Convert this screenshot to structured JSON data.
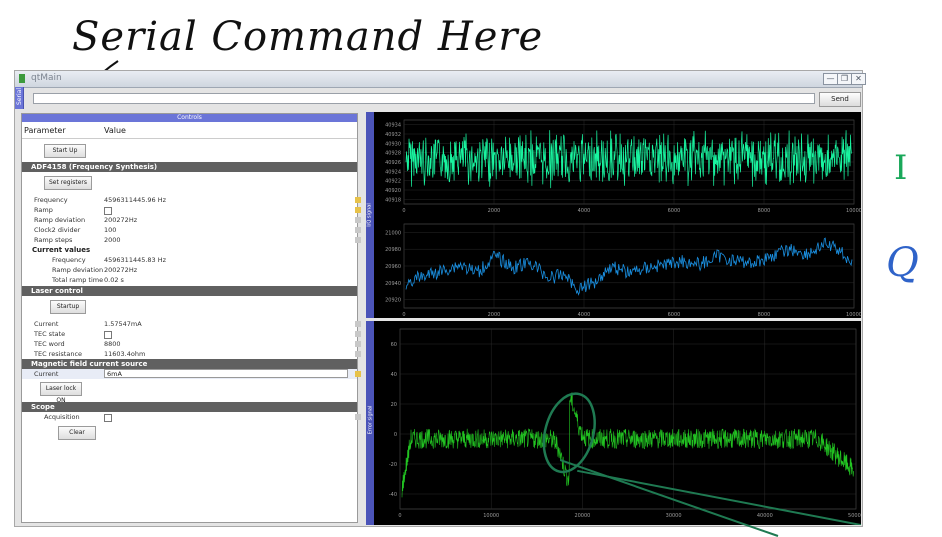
{
  "annotations": {
    "serial_command": "Serial Command Here",
    "i_label": "I",
    "q_label": "Q"
  },
  "window": {
    "title": "qtMain",
    "buttons": [
      "minimize-icon",
      "restore-icon",
      "close-icon"
    ]
  },
  "command": {
    "side_label": "Serial",
    "input_value": "",
    "send_label": "Send"
  },
  "controls": {
    "header": "Controls",
    "col_param": "Parameter",
    "col_value": "Value",
    "startup_button": "Start Up",
    "adf": {
      "title": "ADF4158 (Frequency Synthesis)",
      "set_registers": "Set registers",
      "rows": [
        {
          "label": "Frequency",
          "value": "4596311445.96 Hz"
        },
        {
          "label": "Ramp",
          "value": ""
        },
        {
          "label": "Ramp deviation",
          "value": "200272Hz"
        },
        {
          "label": "Clock2 divider",
          "value": "100"
        },
        {
          "label": "Ramp steps",
          "value": "2000"
        }
      ],
      "current_values_title": "Current values",
      "current_values": [
        {
          "label": "Frequency",
          "value": "4596311445.83 Hz"
        },
        {
          "label": "Ramp deviation",
          "value": "200272Hz"
        },
        {
          "label": "Total ramp time",
          "value": "0.02 s"
        }
      ]
    },
    "laser": {
      "title": "Laser control",
      "startup": "Startup",
      "rows": [
        {
          "label": "Current",
          "value": "1.57547mA"
        },
        {
          "label": "TEC state",
          "value": ""
        },
        {
          "label": "TEC word",
          "value": "8800"
        },
        {
          "label": "TEC resistance",
          "value": "11603.4ohm"
        }
      ]
    },
    "magnetic": {
      "title": "Magnetic field current source",
      "current_label": "Current",
      "current_value": "6mA",
      "laser_lock": "Laser lock ON"
    },
    "scope": {
      "title": "Scope",
      "acquisition_label": "Acquisition",
      "clear": "Clear"
    }
  },
  "plots": {
    "top_side_label": "I/Q signal",
    "bottom_side_label": "Error signal",
    "i_plot": {
      "color": "#19f5a0",
      "yticks": [
        "40934",
        "40932",
        "40930",
        "40928",
        "40926",
        "40924",
        "40922",
        "40920",
        "40918"
      ],
      "xticks": [
        "0",
        "2000",
        "4000",
        "6000",
        "8000",
        "10000"
      ],
      "ylim": [
        40918,
        40934
      ],
      "center": 40926
    },
    "q_plot": {
      "color": "#1a8fe0",
      "yticks": [
        "21000",
        "20980",
        "20960",
        "20940",
        "20920"
      ],
      "xticks": [
        "0",
        "2000",
        "4000",
        "6000",
        "8000",
        "10000"
      ],
      "ylim": [
        20920,
        21000
      ]
    },
    "error_plot": {
      "color": "#22c422",
      "yticks": [
        "60",
        "40",
        "20",
        "0",
        "-20",
        "-40"
      ],
      "xticks": [
        "0",
        "10000",
        "20000",
        "30000",
        "40000",
        "50000"
      ],
      "ylim": [
        -50,
        70
      ],
      "annotation_color": "#1f7a52"
    }
  }
}
